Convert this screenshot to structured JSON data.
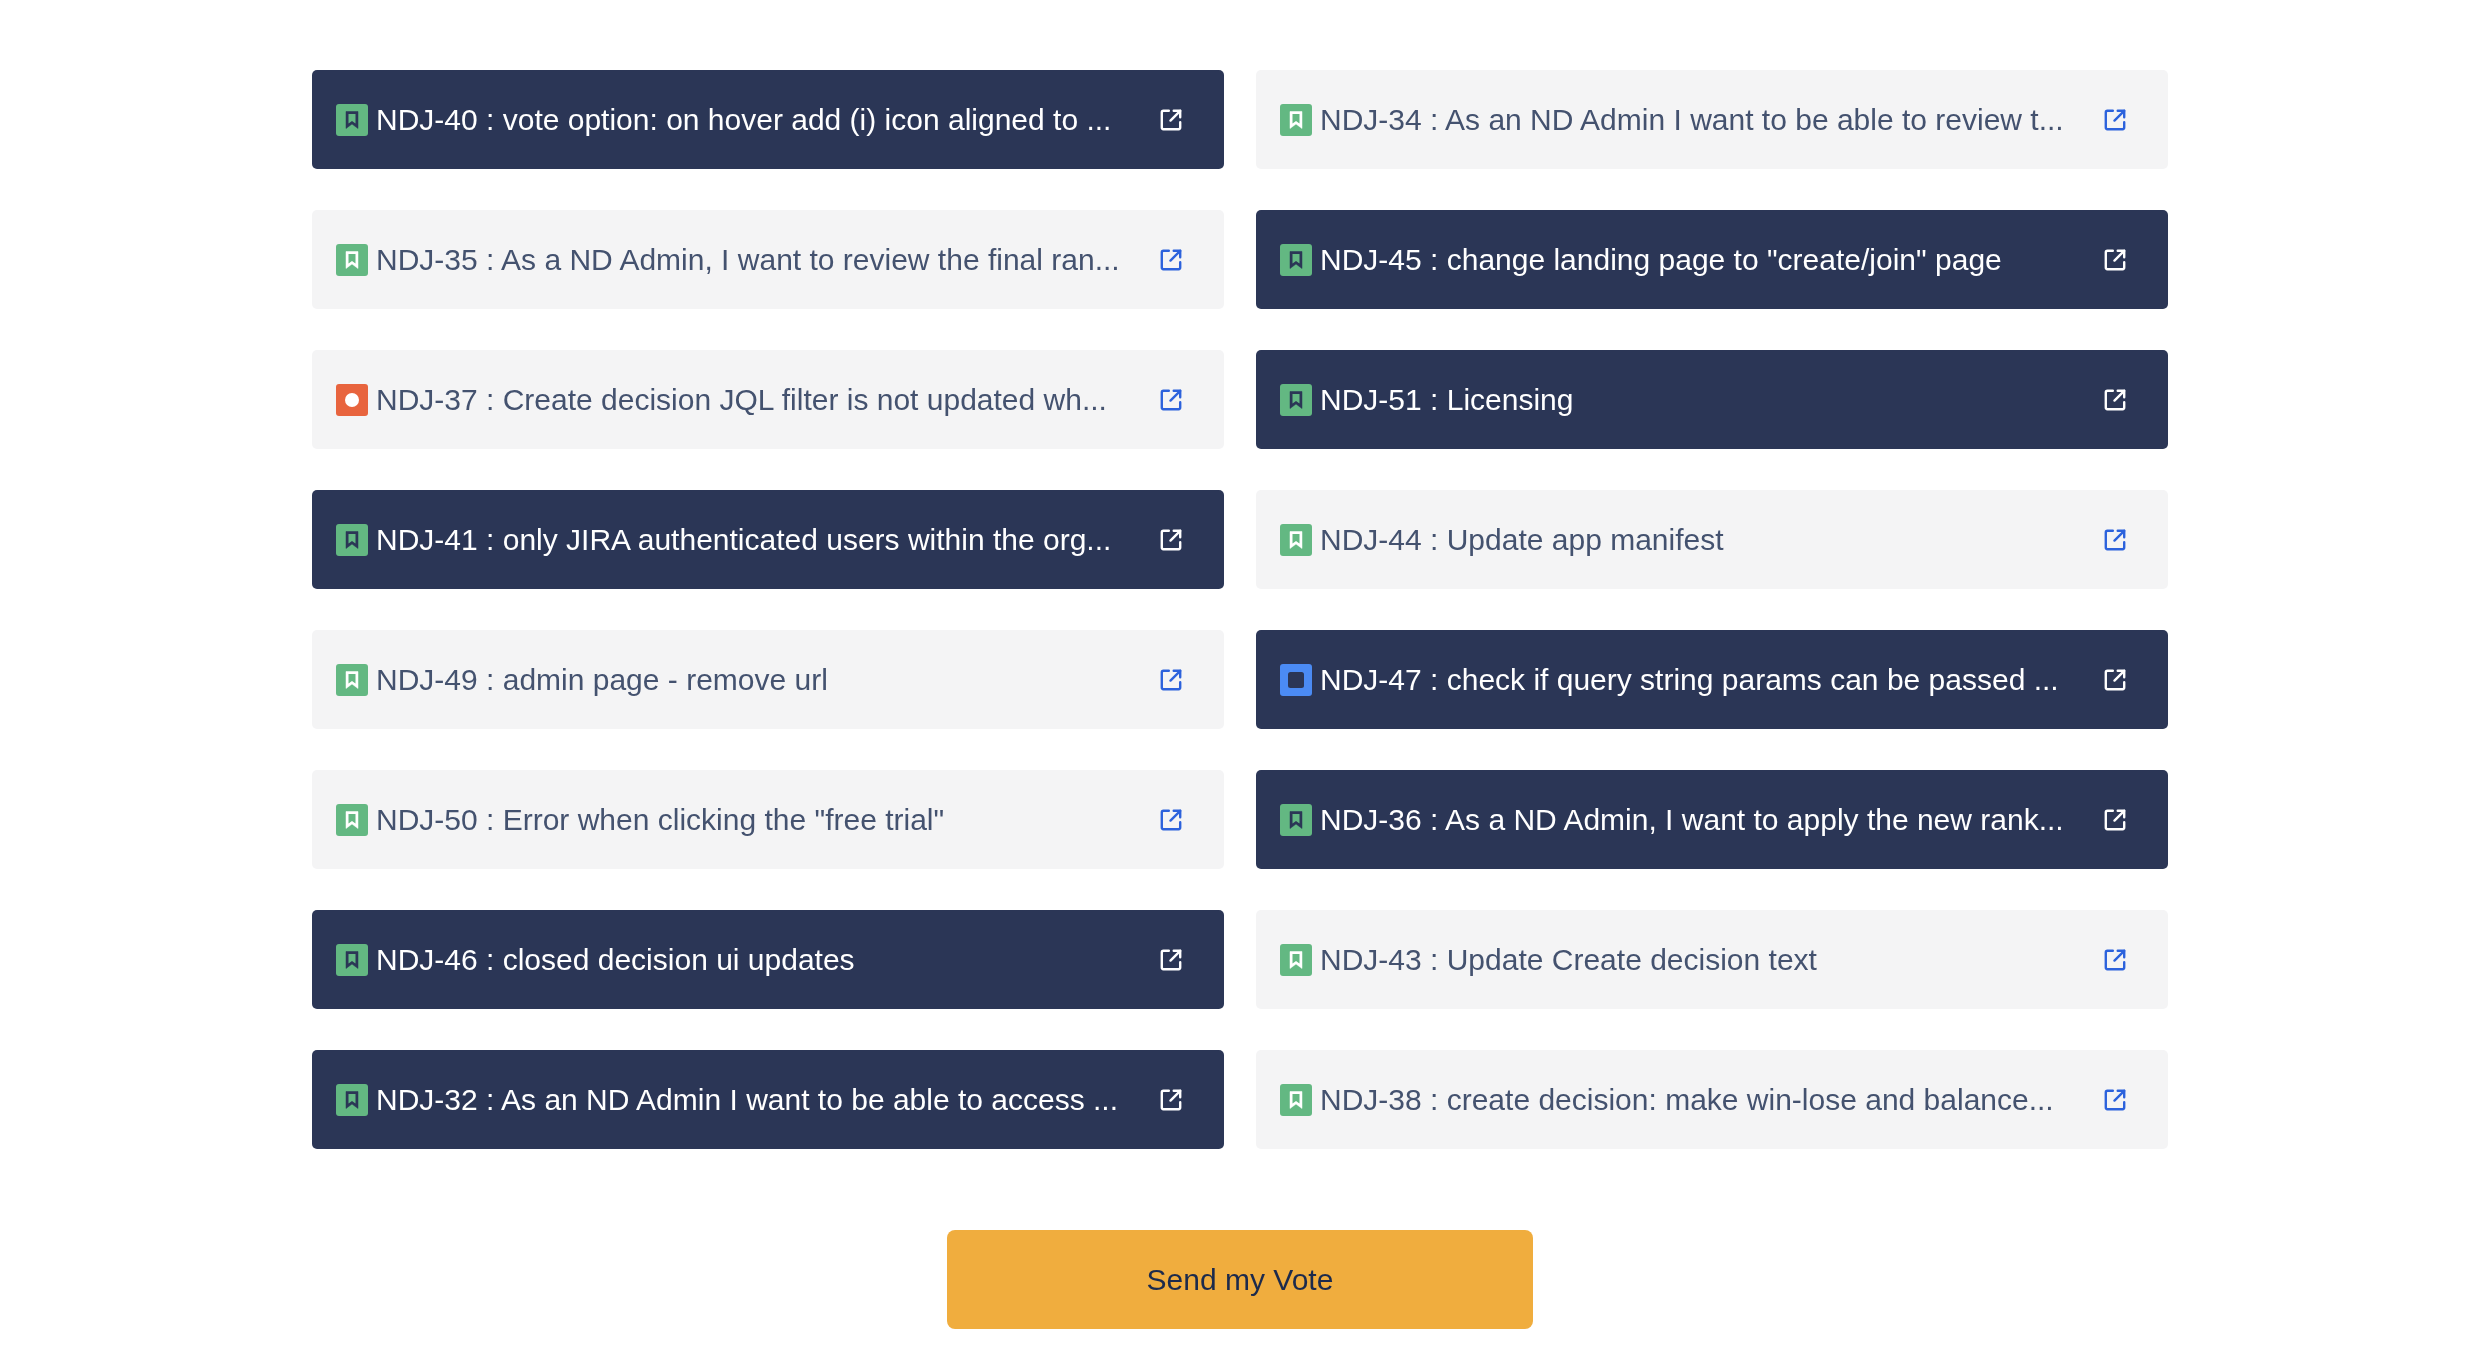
{
  "options": [
    {
      "title": "NDJ-40 : vote option: on hover add (i) icon aligned to ...",
      "kind": "story",
      "selected": true
    },
    {
      "title": "NDJ-34 : As an ND Admin I want to be able to review t...",
      "kind": "story",
      "selected": false
    },
    {
      "title": "NDJ-35 : As a ND Admin, I want to review the final ran...",
      "kind": "story",
      "selected": false
    },
    {
      "title": "NDJ-45 : change landing page to \"create/join\" page",
      "kind": "story",
      "selected": true
    },
    {
      "title": "NDJ-37 : Create decision JQL filter is not updated wh...",
      "kind": "bug",
      "selected": false
    },
    {
      "title": "NDJ-51 : Licensing",
      "kind": "story",
      "selected": true
    },
    {
      "title": "NDJ-41 : only JIRA authenticated users within the org...",
      "kind": "story",
      "selected": true
    },
    {
      "title": "NDJ-44 : Update app manifest",
      "kind": "story",
      "selected": false
    },
    {
      "title": "NDJ-49 : admin page - remove url",
      "kind": "story",
      "selected": false
    },
    {
      "title": "NDJ-47 : check if query string params can be passed ...",
      "kind": "task",
      "selected": true
    },
    {
      "title": "NDJ-50 : Error when clicking the \"free trial\"",
      "kind": "story",
      "selected": false
    },
    {
      "title": "NDJ-36 : As a ND Admin, I want to apply the new rank...",
      "kind": "story",
      "selected": true
    },
    {
      "title": "NDJ-46 : closed decision ui updates",
      "kind": "story",
      "selected": true
    },
    {
      "title": "NDJ-43 : Update Create decision text",
      "kind": "story",
      "selected": false
    },
    {
      "title": "NDJ-32 : As an ND Admin I want to be able to access ...",
      "kind": "story",
      "selected": true
    },
    {
      "title": "NDJ-38 : create decision: make win-lose and balance...",
      "kind": "story",
      "selected": false
    }
  ],
  "submit_button": {
    "label": "Send my Vote"
  }
}
